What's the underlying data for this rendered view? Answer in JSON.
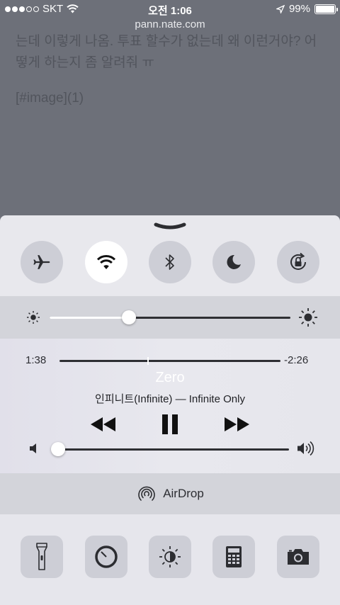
{
  "status_bar": {
    "carrier": "SKT",
    "time": "오전 1:06",
    "battery": "99%",
    "battery_level": 0.99
  },
  "browser": {
    "url": "pann.nate.com"
  },
  "background": {
    "line1": "는데 이렇게 나옴. 투표 할수가 없는데 왜 이런거야? 어떻게 하는지 좀 알려줘 ㅠ",
    "image_ref": "[#image](1)"
  },
  "control_center": {
    "toggles": [
      {
        "name": "airplane-mode",
        "on": false
      },
      {
        "name": "wifi",
        "on": true
      },
      {
        "name": "bluetooth",
        "on": false
      },
      {
        "name": "do-not-disturb",
        "on": false
      },
      {
        "name": "rotation-lock",
        "on": false
      }
    ],
    "brightness_level": 0.33,
    "music": {
      "elapsed": "1:38",
      "remaining": "-2:26",
      "progress": 0.4,
      "title": "Zero",
      "artist_album": "인피니트(Infinite) — Infinite Only",
      "volume_level": 0.0
    },
    "airdrop_label": "AirDrop",
    "apps": [
      "flashlight",
      "timer",
      "night-shift",
      "calculator",
      "camera"
    ]
  },
  "colors": {
    "dim_background": "#6d7079",
    "panel": "#e7e7ed",
    "band": "#d3d4da",
    "button": "#cdced6"
  }
}
